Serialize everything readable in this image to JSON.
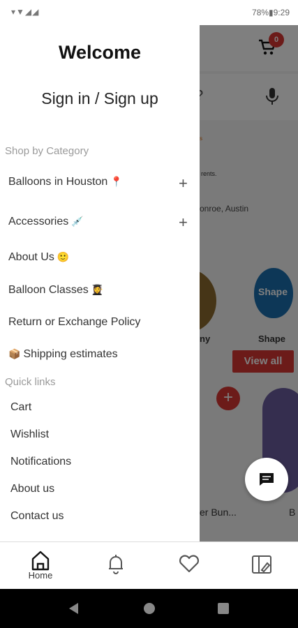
{
  "status": {
    "left": "▾▼◢◢",
    "right": "78%▮9:29"
  },
  "drawer": {
    "welcome": "Welcome",
    "signin": "Sign in / Sign up",
    "shop_heading": "Shop by Category",
    "categories": [
      {
        "label": "Balloons in Houston",
        "emoji": "📍",
        "expand": "+"
      },
      {
        "label": "Accessories",
        "emoji": "💉",
        "expand": "+"
      },
      {
        "label": "About Us",
        "emoji": "🙂"
      },
      {
        "label": "Balloon Classes",
        "emoji": "👩‍🎓"
      },
      {
        "label": "Return or Exchange Policy"
      },
      {
        "label": "Shipping estimates",
        "emoji": "📦"
      }
    ],
    "quick_heading": "Quick links",
    "quick_links": [
      "Cart",
      "Wishlist",
      "Notifications",
      "About us",
      "Contact us"
    ]
  },
  "background": {
    "cart_count": "0",
    "search_tail": "?",
    "orange_text": "s",
    "text1": "rents.",
    "text2": "onroe, Austin",
    "balloon_label": "Shape",
    "cat1": "ny",
    "cat2": "Shape",
    "view_all": "View all",
    "add": "+",
    "product_name": "er Bun...",
    "product_b": "B"
  },
  "bottom_nav": {
    "home": "Home"
  },
  "colors": {
    "accent": "#d93632",
    "scrim": "rgba(0,0,0,0.5)"
  }
}
